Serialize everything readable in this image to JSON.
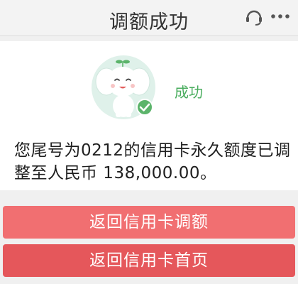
{
  "header": {
    "title": "调额成功"
  },
  "result": {
    "status": "成功",
    "message": "您尾号为0212的信用卡永久额度已调整至人民币  138,000.00。"
  },
  "actions": {
    "adjust_label": "返回信用卡调额",
    "home_label": "返回信用卡首页"
  },
  "colors": {
    "success_green": "#49ad5e",
    "button_primary": "#f16f71",
    "button_secondary": "#e5575b"
  }
}
